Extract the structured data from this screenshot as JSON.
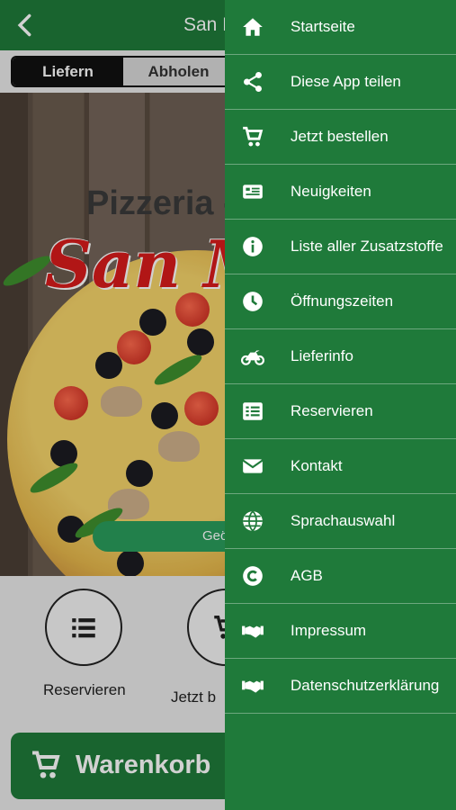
{
  "app": {
    "title": "San M",
    "tabs": {
      "active": "Liefern",
      "inactive": "Abholen"
    },
    "hero": {
      "line1": "Pizzeria - ",
      "line2": "San M",
      "button_fragment": "Geö"
    },
    "quick_actions": [
      {
        "label": "Reservieren"
      },
      {
        "label": "Jetzt b"
      }
    ],
    "cart_label": "Warenkorb"
  },
  "drawer": {
    "items": [
      {
        "label": "Startseite",
        "icon": "home-icon"
      },
      {
        "label": "Diese App teilen",
        "icon": "share-icon"
      },
      {
        "label": "Jetzt bestellen",
        "icon": "cart-icon"
      },
      {
        "label": "Neuigkeiten",
        "icon": "newspaper-icon"
      },
      {
        "label": "Liste aller Zusatzstoffe",
        "icon": "info-icon"
      },
      {
        "label": "Öffnungszeiten",
        "icon": "clock-icon"
      },
      {
        "label": "Lieferinfo",
        "icon": "motorcycle-icon"
      },
      {
        "label": "Reservieren",
        "icon": "list-icon"
      },
      {
        "label": "Kontakt",
        "icon": "envelope-icon"
      },
      {
        "label": "Sprachauswahl",
        "icon": "globe-icon"
      },
      {
        "label": "AGB",
        "icon": "copyright-icon"
      },
      {
        "label": "Impressum",
        "icon": "handshake-icon"
      },
      {
        "label": "Datenschutzerklärung",
        "icon": "handshake-icon"
      }
    ]
  },
  "colors": {
    "brand_green": "#1f7a3a",
    "accent_red": "#d81c1c"
  }
}
